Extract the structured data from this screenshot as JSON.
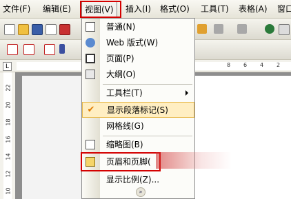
{
  "menubar": {
    "items": [
      {
        "label": "文件(F)"
      },
      {
        "label": "编辑(E)"
      },
      {
        "label": "视图(V)"
      },
      {
        "label": "插入(I)"
      },
      {
        "label": "格式(O)"
      },
      {
        "label": "工具(T)"
      },
      {
        "label": "表格(A)"
      },
      {
        "label": "窗口"
      }
    ]
  },
  "ruler": {
    "h_ticks": [
      "8",
      "6",
      "4",
      "2"
    ],
    "v_ticks": [
      "22",
      "20",
      "18",
      "16",
      "14",
      "12",
      "10"
    ]
  },
  "view_menu": {
    "items": [
      {
        "label": "普通(N)",
        "icon": "normal-view-icon"
      },
      {
        "label": "Web 版式(W)",
        "icon": "web-layout-icon"
      },
      {
        "label": "页面(P)",
        "icon": "print-layout-icon"
      },
      {
        "label": "大纲(O)",
        "icon": "outline-icon"
      },
      {
        "label": "工具栏(T)"
      },
      {
        "label": "显示段落标记(S)",
        "checked": true
      },
      {
        "label": "网格线(G)"
      },
      {
        "label": "缩略图(B)",
        "icon": "thumbnails-icon"
      },
      {
        "label": "页眉和页脚(",
        "icon": "header-footer-icon"
      },
      {
        "label": "显示比例(Z)..."
      }
    ]
  },
  "colors": {
    "highlight_red": "#d40000",
    "menu_hover": "#ffeec2",
    "check_orange": "#e07b00"
  }
}
